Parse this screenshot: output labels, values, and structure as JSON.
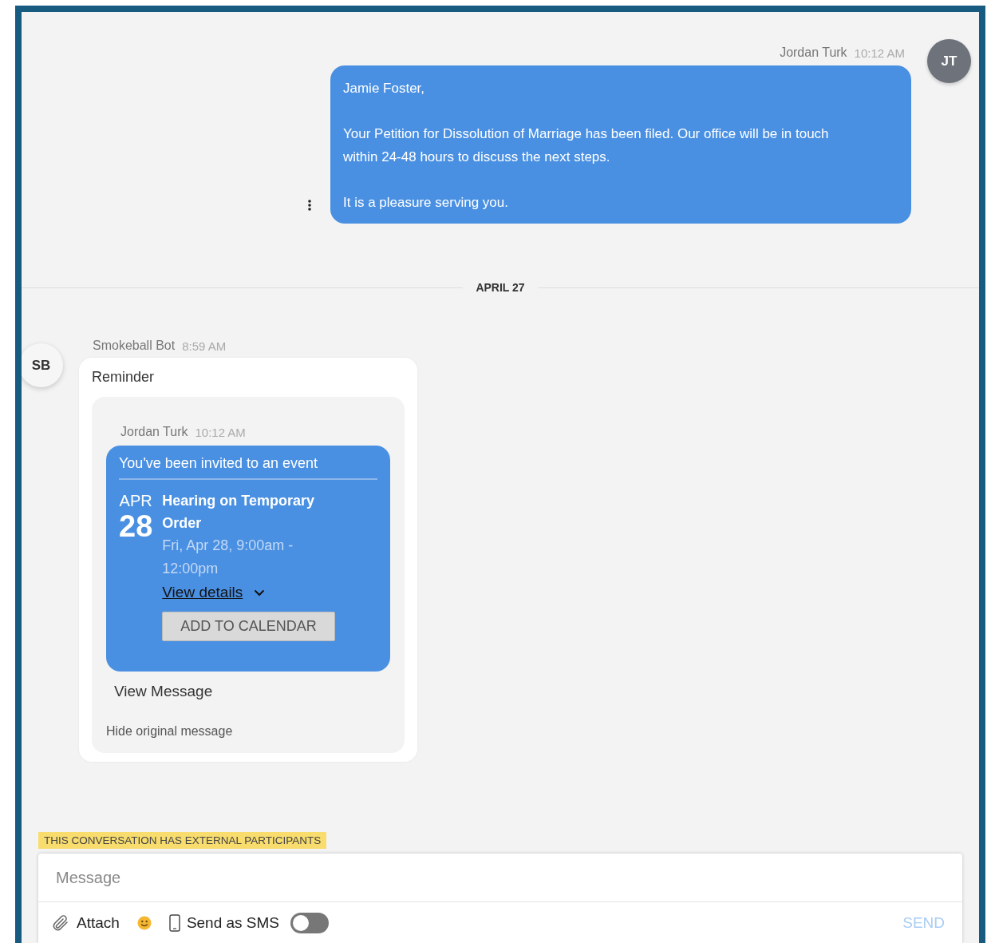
{
  "outgoing": {
    "sender": "Jordan Turk",
    "time": "10:12 AM",
    "avatar": "JT",
    "paragraphs": [
      "Jamie Foster,",
      "Your Petition for Dissolution of Marriage has been filed. Our office will be in touch within 24-48 hours to discuss the next steps.",
      "It is a pleasure serving you."
    ]
  },
  "date_divider": "APRIL 27",
  "incoming": {
    "sender": "Smokeball Bot",
    "time": "8:59 AM",
    "avatar": "SB",
    "title": "Reminder",
    "original": {
      "sender": "Jordan Turk",
      "time": "10:12 AM",
      "heading": "You've been invited to an event",
      "month": "APR",
      "day": "28",
      "event_title": "Hearing on Temporary Order",
      "event_time": "Fri, Apr 28, 9:00am - 12:00pm",
      "details_link": "View details",
      "calendar_button": "ADD TO CALENDAR"
    },
    "view_message": "View Message",
    "hide_link": "Hide original message"
  },
  "banner": "THIS CONVERSATION HAS EXTERNAL PARTICIPANTS",
  "composer": {
    "placeholder": "Message",
    "attach": "Attach",
    "sms_label": "Send as SMS",
    "sms_on": false,
    "send": "SEND",
    "send_disabled": true
  }
}
